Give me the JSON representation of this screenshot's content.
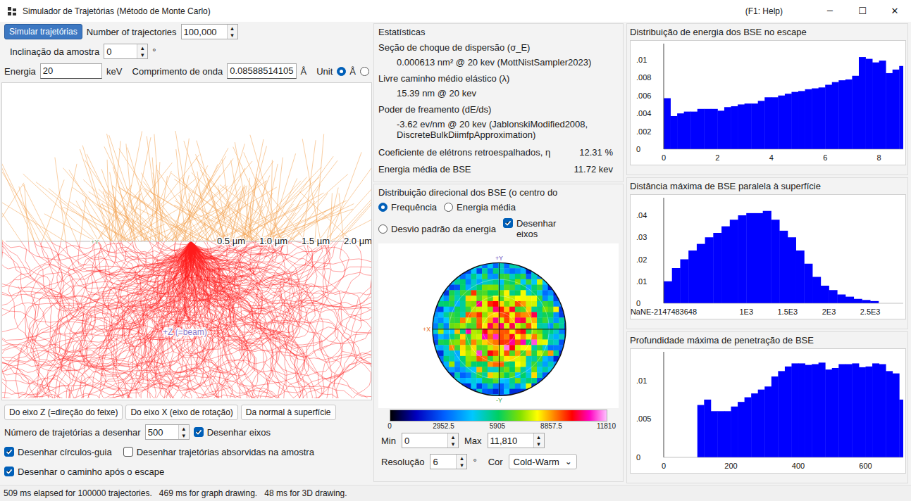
{
  "window": {
    "title": "Simulador de Trajetórias (Método de Monte Carlo)",
    "help": "(F1: Help)",
    "controls": [
      "─",
      "☐",
      "✕"
    ]
  },
  "controls": {
    "simulate_button": {
      "label": "Simular trajetórias",
      "focused": true
    },
    "trajectories": {
      "label": "Number of trajectories",
      "value": "100,000"
    },
    "tilt": {
      "label": "Inclinação da amostra",
      "value": "0",
      "unit": "°"
    },
    "energy": {
      "label": "Energia",
      "value": "20",
      "unit": "keV"
    },
    "wavelength": {
      "label": "Comprimento de onda",
      "value": "0.08588514105",
      "unit": "Å"
    },
    "unit": {
      "label": "Unit",
      "options": [
        {
          "label": "Å",
          "selected": true
        },
        {
          "label": "",
          "selected": false
        }
      ]
    }
  },
  "spinner_arrows": {
    "up": "▴",
    "down": "▾"
  },
  "view": {
    "scale_labels": [
      "0.5 µm",
      "1.0 µm",
      "1.5 µm",
      "2.0 µm"
    ],
    "y_axis_label": "+Y",
    "z_axis_label": "+Z (=beam)"
  },
  "view_buttons": [
    "Do eixo Z (=direção do feixe)",
    "Do eixo X (eixo de rotação)",
    "Da normal à superfície"
  ],
  "draw_options": {
    "count_label": "Número de trajetórias a desenhar",
    "count_value": "500",
    "checkboxes": [
      {
        "label": "Desenhar eixos",
        "checked": true
      },
      {
        "label": "Desenhar círculos-guia",
        "checked": true
      },
      {
        "label": "Desenhar trajetórias absorvidas na amostra",
        "checked": false
      },
      {
        "label": "Desenhar o caminho após o escape",
        "checked": true
      }
    ]
  },
  "statistics": {
    "title": "Estatísticas",
    "items": [
      {
        "label": "Seção de choque de dispersão (σ_E)",
        "value": "0.000613 nm² @ 20 kev (MottNistSampler2023)",
        "kind": "block"
      },
      {
        "label": "Livre caminho médio elástico (λ)",
        "value": "15.39 nm @ 20 kev",
        "kind": "block"
      },
      {
        "label": "Poder de freamento (dE/ds)",
        "value": "-3.62 ev/nm @ 20 kev (JablonskiModified2008, DiscreteBulkDiimfpApproximation)",
        "kind": "block"
      },
      {
        "label": "Coeficiente de elétrons retroespalhados, η",
        "value": "12.31 %",
        "kind": "inline"
      },
      {
        "label": "Energia média de BSE",
        "value": "11.72 kev",
        "kind": "inline"
      }
    ]
  },
  "directional": {
    "title": "Distribuição direcional dos BSE (o centro do",
    "modes": [
      {
        "label": "Frequência",
        "selected": true
      },
      {
        "label": "Energia média",
        "selected": false
      },
      {
        "label": "Desvio padrão da energia",
        "selected": false
      }
    ],
    "draw_axes": {
      "label": "Desenhar eixos",
      "checked": true
    },
    "axis_labels": {
      "top": "+Y",
      "left": "+X",
      "bottom": "-Y"
    },
    "colorbar_ticks": [
      "0",
      "2952.5",
      "5905",
      "8857.5",
      "11810"
    ],
    "min": {
      "label": "Min",
      "value": "0"
    },
    "max": {
      "label": "Max",
      "value": "11,810"
    },
    "resolution": {
      "label": "Resolução",
      "value": "6",
      "unit": "°"
    },
    "color": {
      "label": "Cor",
      "value": "Cold-Warm",
      "chevron": "⌄"
    }
  },
  "charts": [
    {
      "title": "Distribuição de energia dos BSE no escape",
      "x_range": [
        0,
        8.9
      ],
      "y_range": [
        0,
        0.0118
      ],
      "bin_start": 0,
      "bin_width": 0.25,
      "values": [
        0.0057,
        0.0037,
        0.004,
        0.0042,
        0.0042,
        0.0045,
        0.0045,
        0.0045,
        0.0043,
        0.0047,
        0.0048,
        0.005,
        0.0051,
        0.0051,
        0.0054,
        0.0058,
        0.0058,
        0.006,
        0.0062,
        0.0064,
        0.0065,
        0.0067,
        0.0068,
        0.0069,
        0.0072,
        0.0075,
        0.0077,
        0.0078,
        0.0082,
        0.0103,
        0.0101,
        0.0097,
        0.0099,
        0.0085,
        0.0089,
        0.0093
      ],
      "y_ticks": [
        {
          "label": ".01",
          "value": 0.01
        },
        {
          "label": ".008",
          "value": 0.008
        },
        {
          "label": ".006",
          "value": 0.006
        },
        {
          "label": ".004",
          "value": 0.004
        },
        {
          "label": ".002",
          "value": 0.002
        },
        {
          "label": "0",
          "value": 0
        }
      ],
      "x_ticks": [
        {
          "label": "0",
          "value": 0
        },
        {
          "label": "2",
          "value": 2
        },
        {
          "label": "4",
          "value": 4
        },
        {
          "label": "6",
          "value": 6
        },
        {
          "label": "8",
          "value": 8
        }
      ]
    },
    {
      "title": "Distância máxima de BSE paralela à superfície",
      "x_range": [
        0,
        2900
      ],
      "y_range": [
        0,
        0.048
      ],
      "bin_start": 0,
      "bin_width": 100,
      "values": [
        0.01,
        0.016,
        0.02,
        0.024,
        0.027,
        0.03,
        0.032,
        0.035,
        0.038,
        0.04,
        0.041,
        0.041,
        0.042,
        0.038,
        0.033,
        0.03,
        0.024,
        0.018,
        0.012,
        0.008,
        0.006,
        0.004,
        0.003,
        0.002,
        0.0015,
        0.001
      ],
      "y_ticks": [
        {
          "label": ".04",
          "value": 0.04
        },
        {
          "label": ".03",
          "value": 0.03
        },
        {
          "label": ".02",
          "value": 0.02
        },
        {
          "label": ".01",
          "value": 0.01
        },
        {
          "label": "0",
          "value": 0
        }
      ],
      "x_ticks": [
        {
          "label": "NaNE-2147483648",
          "value": 0
        },
        {
          "label": "1E3",
          "value": 1000
        },
        {
          "label": "1.5E3",
          "value": 1500
        },
        {
          "label": "2E3",
          "value": 2000
        },
        {
          "label": "2.5E3",
          "value": 2500
        }
      ]
    },
    {
      "title": "Profundidade máxima de penetração de BSE",
      "x_range": [
        0,
        712
      ],
      "y_range": [
        0,
        0.0137
      ],
      "bin_start": 100,
      "bin_width": 20,
      "values": [
        0.0068,
        0.0075,
        0.006,
        0.006,
        0.006,
        0.0066,
        0.0072,
        0.0078,
        0.0083,
        0.0088,
        0.0092,
        0.0105,
        0.0112,
        0.0118,
        0.0122,
        0.0122,
        0.012,
        0.0121,
        0.0123,
        0.0114,
        0.0116,
        0.0121,
        0.0121,
        0.0122,
        0.0117,
        0.0118,
        0.0122,
        0.0121,
        0.0112,
        0.0109,
        0.0075
      ],
      "y_ticks": [
        {
          "label": ".01",
          "value": 0.01
        },
        {
          "label": ".005",
          "value": 0.005
        },
        {
          "label": "0",
          "value": 0
        }
      ],
      "x_ticks": [
        {
          "label": "0",
          "value": 0
        },
        {
          "label": "200",
          "value": 200
        },
        {
          "label": "400",
          "value": 400
        },
        {
          "label": "600",
          "value": 600
        }
      ]
    }
  ],
  "status_bar": "509 ms elapsed for 100000 trajectories.   469 ms for graph drawing.   48 ms for 3D drawing."
}
